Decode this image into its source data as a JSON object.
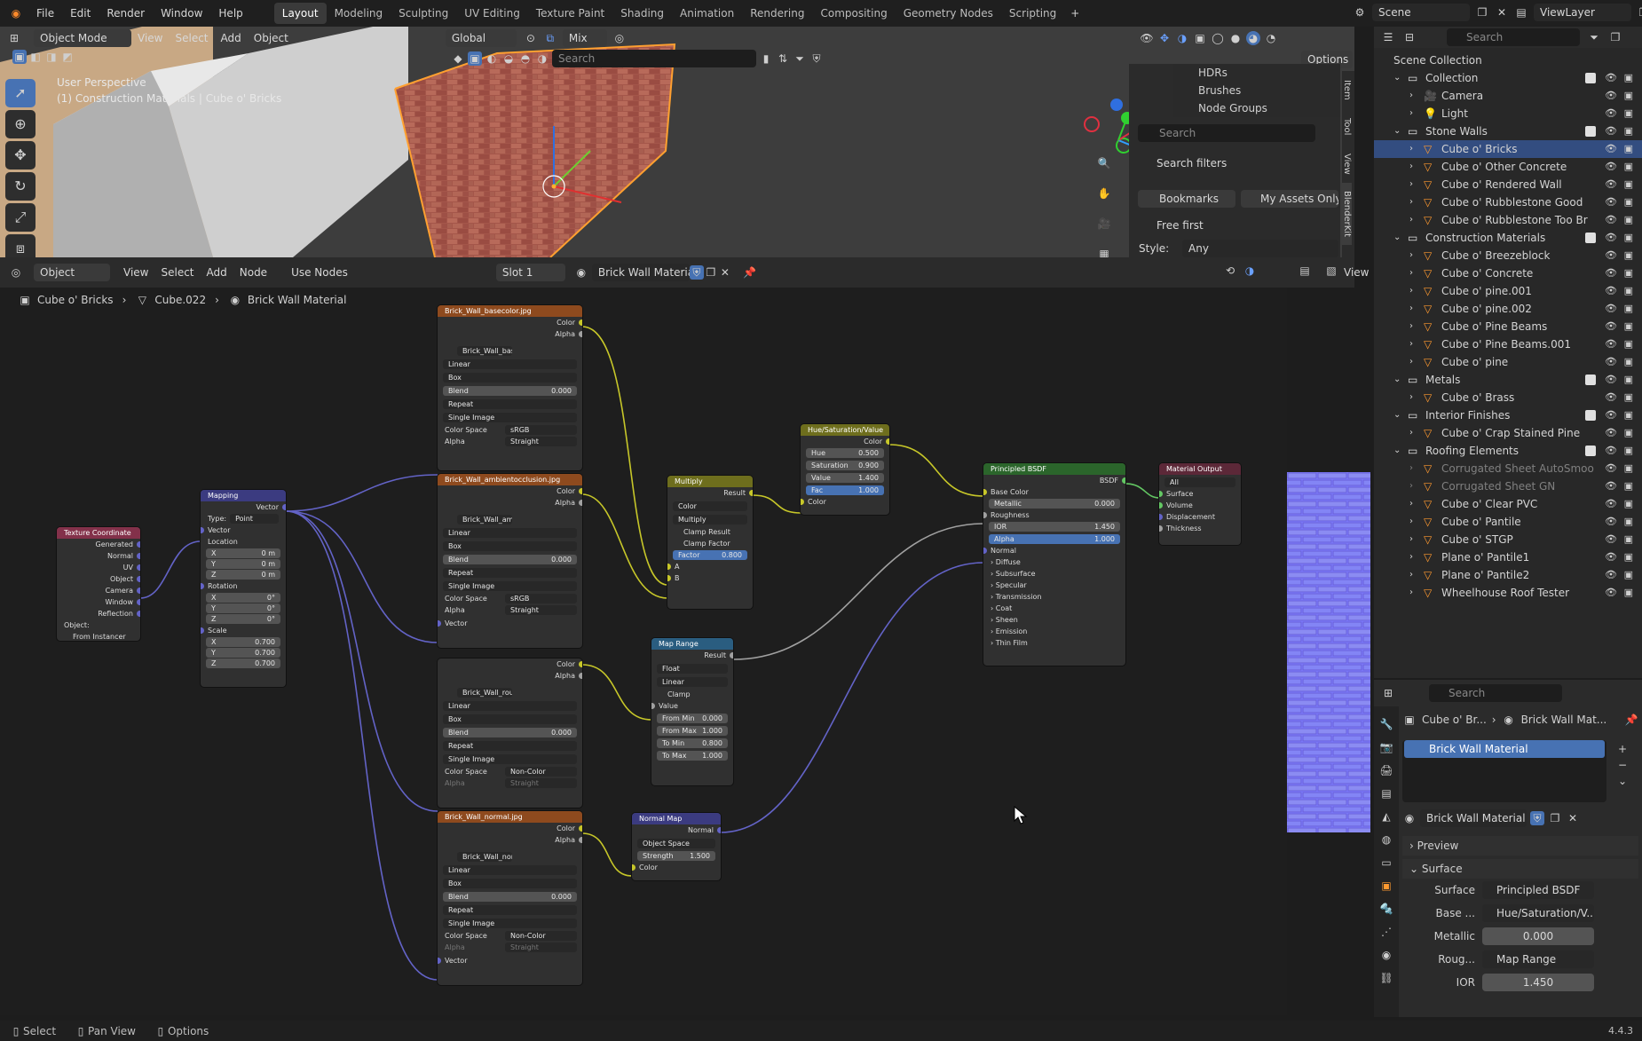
{
  "menu": {
    "file": "File",
    "edit": "Edit",
    "render": "Render",
    "window": "Window",
    "help": "Help"
  },
  "workspaces": [
    "Layout",
    "Modeling",
    "Sculpting",
    "UV Editing",
    "Texture Paint",
    "Shading",
    "Animation",
    "Rendering",
    "Compositing",
    "Geometry Nodes",
    "Scripting"
  ],
  "scene": {
    "label": "Scene",
    "viewlayer": "ViewLayer"
  },
  "viewport": {
    "mode": "Object Mode",
    "menus": [
      "View",
      "Select",
      "Add",
      "Object"
    ],
    "orientation": "Global",
    "blend": "Mix",
    "search_placeholder": "Search",
    "options": "Options",
    "info_line1": "User Perspective",
    "info_line2": "(1) Construction Materials | Cube o' Bricks",
    "side_tabs": [
      "Item",
      "Tool",
      "View",
      "BlenderKit"
    ]
  },
  "asset_panel": {
    "items": [
      "HDRs",
      "Brushes",
      "Node Groups"
    ],
    "search_placeholder": "Search",
    "search_filters": "Search filters",
    "bookmarks": "Bookmarks",
    "my_assets": "My Assets Only",
    "free_first": "Free first",
    "style_label": "Style:",
    "style_value": "Any"
  },
  "node_header": {
    "editor": "Object",
    "menus": [
      "View",
      "Select",
      "Add",
      "Node"
    ],
    "use_nodes": "Use Nodes",
    "slot": "Slot 1",
    "material": "Brick Wall Material",
    "view": "View"
  },
  "breadcrumb": {
    "object": "Cube o' Bricks",
    "mesh": "Cube.022",
    "material": "Brick Wall Material"
  },
  "nodes": {
    "texcoord": {
      "title": "Texture Coordinate",
      "outputs": [
        "Generated",
        "Normal",
        "UV",
        "Object",
        "Camera",
        "Window",
        "Reflection"
      ],
      "object_label": "Object:",
      "from_instancer": "From Instancer"
    },
    "mapping": {
      "title": "Mapping",
      "vector_out": "Vector",
      "type_label": "Type:",
      "type_value": "Point",
      "vector_in": "Vector",
      "location": "Location",
      "loc": [
        "0 m",
        "0 m",
        "0 m"
      ],
      "rotation": "Rotation",
      "rot": [
        "0°",
        "0°",
        "0°"
      ],
      "scale": "Scale",
      "scl": [
        "0.700",
        "0.700",
        "0.700"
      ],
      "axes": [
        "X",
        "Y",
        "Z"
      ]
    },
    "img_base": {
      "title": "Brick_Wall_basecolor.jpg",
      "file": "Brick_Wall_base...",
      "interp": "Linear",
      "proj": "Box",
      "blend_label": "Blend",
      "blend_value": "0.000",
      "ext": "Repeat",
      "source": "Single Image",
      "cs_label": "Color Space",
      "cs_value": "sRGB",
      "alpha_label": "Alpha",
      "alpha_value": "Straight",
      "color": "Color",
      "alpha": "Alpha"
    },
    "img_ao": {
      "title": "Brick_Wall_ambientocclusion.jpg",
      "file": "Brick_Wall_ambi...",
      "interp": "Linear",
      "proj": "Box",
      "blend_label": "Blend",
      "blend_value": "0.000",
      "ext": "Repeat",
      "source": "Single Image",
      "cs_label": "Color Space",
      "cs_value": "sRGB",
      "alpha_label": "Alpha",
      "alpha_value": "Straight",
      "vector": "Vector",
      "color": "Color",
      "alpha": "Alpha"
    },
    "img_rough": {
      "file": "Brick_Wall_rough...",
      "interp": "Linear",
      "proj": "Box",
      "blend_label": "Blend",
      "blend_value": "0.000",
      "ext": "Repeat",
      "source": "Single Image",
      "cs_label": "Color Space",
      "cs_value": "Non-Color",
      "alpha_label": "Alpha",
      "alpha_value": "Straight",
      "color": "Color",
      "alpha": "Alpha"
    },
    "img_normal": {
      "title": "Brick_Wall_normal.jpg",
      "file": "Brick_Wall_norm...",
      "interp": "Linear",
      "proj": "Box",
      "blend_label": "Blend",
      "blend_value": "0.000",
      "ext": "Repeat",
      "source": "Single Image",
      "cs_label": "Color Space",
      "cs_value": "Non-Color",
      "alpha_label": "Alpha",
      "alpha_value": "Straight",
      "vector": "Vector",
      "color": "Color",
      "alpha": "Alpha"
    },
    "multiply": {
      "title": "Multiply",
      "result": "Result",
      "type": "Color",
      "op": "Multiply",
      "clamp_result": "Clamp Result",
      "clamp_factor": "Clamp Factor",
      "factor_label": "Factor",
      "factor_value": "0.800",
      "a": "A",
      "b": "B"
    },
    "huesat": {
      "title": "Hue/Saturation/Value",
      "color_out": "Color",
      "hue_label": "Hue",
      "hue": "0.500",
      "sat_label": "Saturation",
      "sat": "0.900",
      "val_label": "Value",
      "val": "1.400",
      "fac_label": "Fac",
      "fac": "1.000",
      "color_in": "Color"
    },
    "maprange": {
      "title": "Map Range",
      "result": "Result",
      "type": "Float",
      "interp": "Linear",
      "clamp": "Clamp",
      "value": "Value",
      "from_min_label": "From Min",
      "from_min": "0.000",
      "from_max_label": "From Max",
      "from_max": "1.000",
      "to_min_label": "To Min",
      "to_min": "0.800",
      "to_max_label": "To Max",
      "to_max": "1.000"
    },
    "normalmap": {
      "title": "Normal Map",
      "normal": "Normal",
      "space": "Object Space",
      "strength_label": "Strength",
      "strength": "1.500",
      "color": "Color"
    },
    "bsdf": {
      "title": "Principled BSDF",
      "bsdf": "BSDF",
      "base_color": "Base Color",
      "metallic_label": "Metallic",
      "metallic": "0.000",
      "roughness": "Roughness",
      "ior_label": "IOR",
      "ior": "1.450",
      "alpha_label": "Alpha",
      "alpha": "1.000",
      "normal": "Normal",
      "panels": [
        "Diffuse",
        "Subsurface",
        "Specular",
        "Transmission",
        "Coat",
        "Sheen",
        "Emission",
        "Thin Film"
      ]
    },
    "output": {
      "title": "Material Output",
      "target": "All",
      "inputs": [
        "Surface",
        "Volume",
        "Displacement",
        "Thickness"
      ]
    }
  },
  "outliner": {
    "search_placeholder": "Search",
    "root": "Scene Collection",
    "rows": [
      {
        "name": "Collection",
        "level": 1,
        "type": "collection",
        "check": true
      },
      {
        "name": "Camera",
        "level": 2,
        "type": "camera"
      },
      {
        "name": "Light",
        "level": 2,
        "type": "light"
      },
      {
        "name": "Stone Walls",
        "level": 1,
        "type": "collection",
        "check": true
      },
      {
        "name": "Cube o' Bricks",
        "level": 2,
        "type": "mesh",
        "highlight": true
      },
      {
        "name": "Cube o' Other Concrete",
        "level": 2,
        "type": "mesh"
      },
      {
        "name": "Cube o' Rendered Wall",
        "level": 2,
        "type": "mesh"
      },
      {
        "name": "Cube o' Rubblestone Good",
        "level": 2,
        "type": "mesh"
      },
      {
        "name": "Cube o' Rubblestone Too Br",
        "level": 2,
        "type": "mesh"
      },
      {
        "name": "Construction Materials",
        "level": 1,
        "type": "collection",
        "check": true
      },
      {
        "name": "Cube o' Breezeblock",
        "level": 2,
        "type": "mesh"
      },
      {
        "name": "Cube o' Concrete",
        "level": 2,
        "type": "mesh"
      },
      {
        "name": "Cube o' pine.001",
        "level": 2,
        "type": "mesh"
      },
      {
        "name": "Cube o' pine.002",
        "level": 2,
        "type": "mesh"
      },
      {
        "name": "Cube o' Pine Beams",
        "level": 2,
        "type": "mesh"
      },
      {
        "name": "Cube o' Pine Beams.001",
        "level": 2,
        "type": "mesh"
      },
      {
        "name": "Cube o' pine",
        "level": 2,
        "type": "mesh"
      },
      {
        "name": "Metals",
        "level": 1,
        "type": "collection",
        "check": true
      },
      {
        "name": "Cube o' Brass",
        "level": 2,
        "type": "mesh"
      },
      {
        "name": "Interior Finishes",
        "level": 1,
        "type": "collection",
        "check": true
      },
      {
        "name": "Cube o' Crap Stained Pine",
        "level": 2,
        "type": "mesh"
      },
      {
        "name": "Roofing Elements",
        "level": 1,
        "type": "collection",
        "check": true
      },
      {
        "name": "Corrugated Sheet AutoSmoo",
        "level": 2,
        "type": "mesh",
        "dim": true
      },
      {
        "name": "Corrugated Sheet GN",
        "level": 2,
        "type": "mesh",
        "dim": true
      },
      {
        "name": "Cube o' Clear PVC",
        "level": 2,
        "type": "mesh"
      },
      {
        "name": "Cube o' Pantile",
        "level": 2,
        "type": "mesh"
      },
      {
        "name": "Cube o' STGP",
        "level": 2,
        "type": "mesh"
      },
      {
        "name": "Plane o' Pantile1",
        "level": 2,
        "type": "mesh"
      },
      {
        "name": "Plane o' Pantile2",
        "level": 2,
        "type": "mesh"
      },
      {
        "name": "Wheelhouse Roof Tester",
        "level": 2,
        "type": "mesh"
      }
    ]
  },
  "properties": {
    "search_placeholder": "Search",
    "crumb_object": "Cube o' Br...",
    "crumb_material": "Brick Wall Mat...",
    "slot_name": "Brick Wall Material",
    "material_name": "Brick Wall Material",
    "preview": "Preview",
    "surface_panel": "Surface",
    "surface_label": "Surface",
    "surface_value": "Principled BSDF",
    "base_label": "Base ...",
    "base_value": "Hue/Saturation/V...",
    "metallic_label": "Metallic",
    "metallic_value": "0.000",
    "rough_label": "Roug...",
    "rough_value": "Map Range",
    "ior_label": "IOR",
    "ior_value": "1.450"
  },
  "status": {
    "select": "Select",
    "pan": "Pan View",
    "options": "Options",
    "version": "4.4.3"
  },
  "colors": {
    "accent": "#4772b3",
    "image_node": "#8e4a1e",
    "vector_node": "#3b3b80",
    "input_node": "#83314a",
    "color_node": "#6e6e1d",
    "shader_node": "#2b652b",
    "output_node": "#5c2838"
  }
}
